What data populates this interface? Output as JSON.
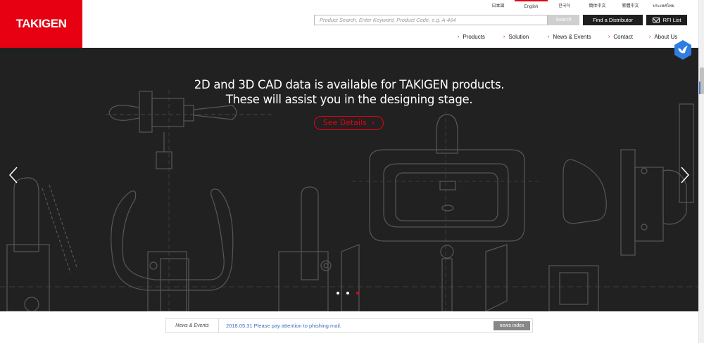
{
  "header": {
    "logo_text": "TAKIGEN",
    "languages": [
      "日本語",
      "English",
      "한국어",
      "簡体中文",
      "繁體中文",
      "ประเทศไทย"
    ],
    "active_language": "English",
    "search": {
      "placeholder": "Product Search, Enter Keyword, Product Code, e.g. A-464",
      "button_label": "Search"
    },
    "find_distributor_label": "Find a Distributor",
    "rfi_label": "RFI List",
    "nav": [
      "Products",
      "Solution",
      "News & Events",
      "Contact",
      "About Us"
    ]
  },
  "hero": {
    "line1": "2D and 3D CAD data is available for TAKIGEN products.",
    "line2": "These will assist you in the designing stage.",
    "cta_label": "See Details",
    "slide_count": 3,
    "active_slide": 3
  },
  "news": {
    "label": "News & Events",
    "headline": "2018.05.31 Please pay attention to phishing mail.",
    "index_label": "news index"
  },
  "colors": {
    "brand_red": "#e60012",
    "hero_bg": "#212121",
    "link_blue": "#3b6fc2"
  }
}
